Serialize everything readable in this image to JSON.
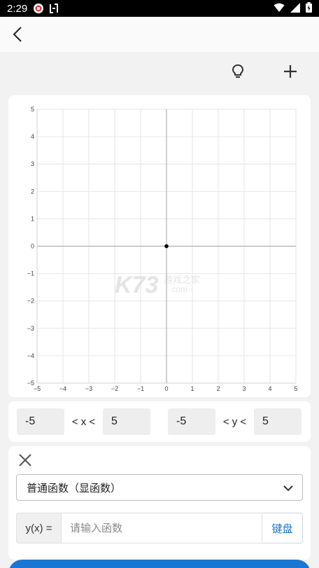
{
  "status_bar": {
    "time": "2:29"
  },
  "graph": {
    "x_ticks": [
      "−5",
      "−4",
      "−3",
      "−2",
      "−1",
      "0",
      "1",
      "2",
      "3",
      "4",
      "5"
    ],
    "y_ticks": [
      "5",
      "4",
      "3",
      "2",
      "1",
      "0",
      "−1",
      "−2",
      "−3",
      "−4",
      "−5"
    ],
    "watermark": "K73",
    "watermark_sub": "游戏之家",
    "watermark_url": ".com"
  },
  "range": {
    "x_min": "-5",
    "x_label": "< x <",
    "x_max": "5",
    "y_min": "-5",
    "y_label": "< y <",
    "y_max": "5"
  },
  "function_editor": {
    "type_value": "普通函数（显函数）",
    "prefix": "y(x) =",
    "input_placeholder": "请输入函数",
    "keyboard_label": "键盘"
  },
  "colors": {
    "accent": "#1976d2",
    "grid": "#e6e6e6",
    "axis": "#b0b0b0"
  }
}
